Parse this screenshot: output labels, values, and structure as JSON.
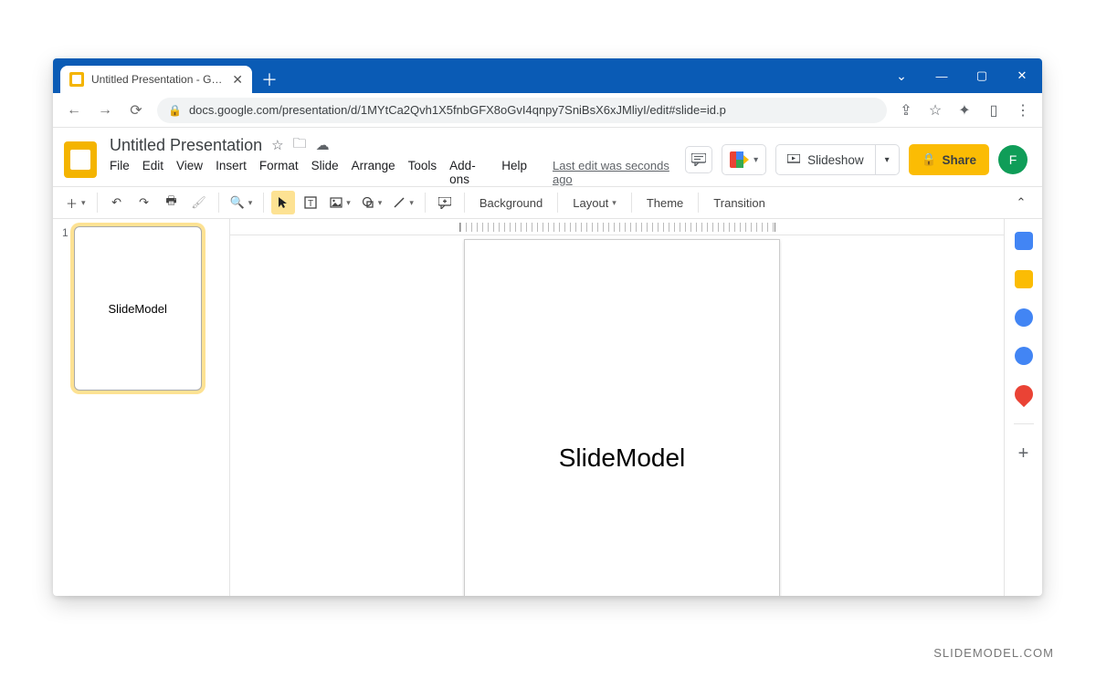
{
  "browser": {
    "tab_title": "Untitled Presentation - Google S",
    "url": "docs.google.com/presentation/d/1MYtCa2Qvh1X5fnbGFX8oGvI4qnpy7SniBsX6xJMliyI/edit#slide=id.p"
  },
  "doc": {
    "title": "Untitled Presentation",
    "last_edit": "Last edit was seconds ago"
  },
  "menus": {
    "file": "File",
    "edit": "Edit",
    "view": "View",
    "insert": "Insert",
    "format": "Format",
    "slide": "Slide",
    "arrange": "Arrange",
    "tools": "Tools",
    "addons": "Add-ons",
    "help": "Help"
  },
  "header_buttons": {
    "slideshow": "Slideshow",
    "share": "Share"
  },
  "avatar_initial": "F",
  "toolbar": {
    "background": "Background",
    "layout": "Layout",
    "theme": "Theme",
    "transition": "Transition"
  },
  "thumbnail": {
    "number": "1",
    "text": "SlideModel"
  },
  "canvas_text": "SlideModel",
  "watermark": "SLIDEMODEL.COM"
}
